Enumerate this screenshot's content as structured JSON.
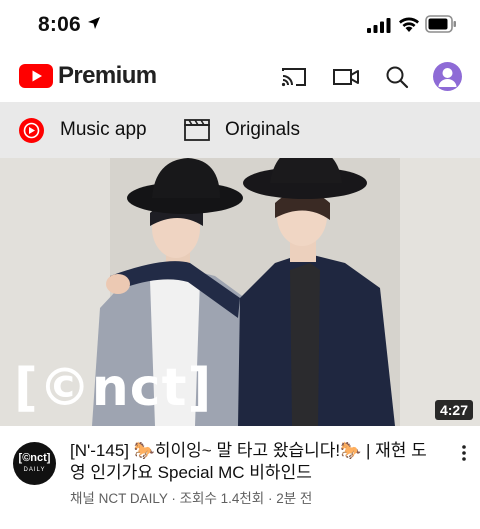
{
  "status_bar": {
    "time": "8:06"
  },
  "header": {
    "brand": "Premium",
    "icons": [
      "youtube-logo-icon",
      "cast-icon",
      "camera-icon",
      "search-icon",
      "avatar"
    ]
  },
  "chips": [
    {
      "label": "Music app",
      "icon": "music-app-icon"
    },
    {
      "label": "Originals",
      "icon": "clapperboard-icon"
    }
  ],
  "video": {
    "watermark": "[©nct]",
    "duration": "4:27",
    "title": "[N'-145] 🐎히이잉~ 말 타고 왔습니다!🐎 | 재현 도영 인기가요 Special MC 비하인드",
    "subtitle": "채널 NCT DAILY · 조회수 1.4천회 · 2분 전",
    "channel_avatar_top": "[©nct]",
    "channel_avatar_bottom": "DAILY"
  },
  "colors": {
    "brand_red": "#ff0000",
    "chip_bar_bg": "#e9e9e9",
    "avatar_purple": "#8e6bd6",
    "secondary_text": "#606060"
  }
}
